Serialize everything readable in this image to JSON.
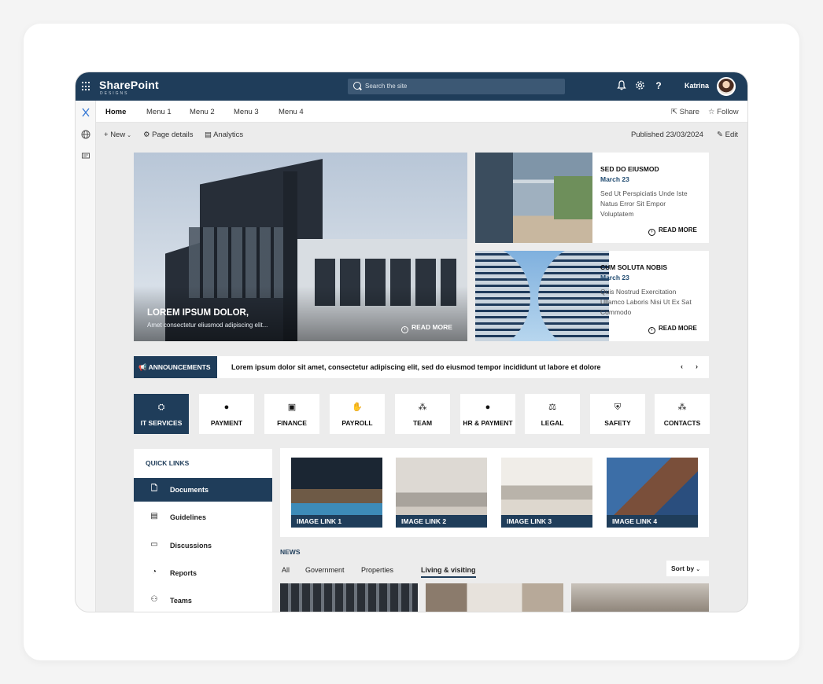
{
  "brand": {
    "name": "SharePoint",
    "sub": "DESIGNS"
  },
  "search": {
    "placeholder": "Search the site"
  },
  "user": {
    "name": "Katrina"
  },
  "topbar_icons": [
    "bell-icon",
    "gear-icon",
    "help-icon"
  ],
  "menu": {
    "items": [
      "Home",
      "Menu 1",
      "Menu 2",
      "Menu 3",
      "Menu 4"
    ],
    "share": "Share",
    "follow": "Follow"
  },
  "commands": {
    "new": "New",
    "page_details": "Page details",
    "analytics": "Analytics",
    "published": "Published 23/03/2024",
    "edit": "Edit"
  },
  "hero": {
    "title": "LOREM IPSUM DOLOR,",
    "subtitle": "Amet consectetur eliusmod adipiscing elit...",
    "read_more": "READ MORE"
  },
  "side_cards": [
    {
      "title": "SED DO EIUSMOD",
      "date": "March 23",
      "body": "Sed Ut Perspiciatis Unde Iste Natus Error Sit Empor Voluptatem",
      "read_more": "READ MORE"
    },
    {
      "title": "CUM SOLUTA NOBIS",
      "date": "March 23",
      "body": "Quis Nostrud Exercitation Ullamco Laboris Nisi Ut Ex Sat Commodo",
      "read_more": "READ MORE"
    }
  ],
  "announcements": {
    "label": "ANNOUNCEMENTS",
    "text": "Lorem ipsum dolor sit amet, consectetur adipiscing elit, sed do eiusmod tempor incididunt ut labore et dolore",
    "prev": "‹",
    "next": "›"
  },
  "tiles": [
    {
      "label": "IT SERVICES",
      "icon": "people-network-icon"
    },
    {
      "label": "PAYMENT",
      "icon": "person-coin-icon"
    },
    {
      "label": "FINANCE",
      "icon": "finance-icon"
    },
    {
      "label": "PAYROLL",
      "icon": "hand-money-icon"
    },
    {
      "label": "TEAM",
      "icon": "team-icon"
    },
    {
      "label": "HR & PAYMENT",
      "icon": "person-coin-icon"
    },
    {
      "label": "LEGAL",
      "icon": "gavel-icon"
    },
    {
      "label": "SAFETY",
      "icon": "shield-icon"
    },
    {
      "label": "CONTACTS",
      "icon": "contacts-icon"
    }
  ],
  "quick_links": {
    "title": "QUICK LINKS",
    "items": [
      {
        "label": "Documents",
        "icon": "document-icon"
      },
      {
        "label": "Guidelines",
        "icon": "card-icon"
      },
      {
        "label": "Discussions",
        "icon": "chat-icon"
      },
      {
        "label": "Reports",
        "icon": "pie-chart-icon"
      },
      {
        "label": "Teams",
        "icon": "people-icon"
      }
    ]
  },
  "image_links": [
    "IMAGE LINK 1",
    "IMAGE LINK 2",
    "IMAGE LINK 3",
    "IMAGE LINK 4"
  ],
  "news": {
    "title": "NEWS",
    "tabs": [
      "All",
      "Government",
      "Properties",
      "Living & visiting"
    ],
    "selected_tab": "Living & visiting",
    "sort": "Sort by"
  },
  "colors": {
    "accent": "#1f3d5a",
    "canvas": "#ececec"
  }
}
